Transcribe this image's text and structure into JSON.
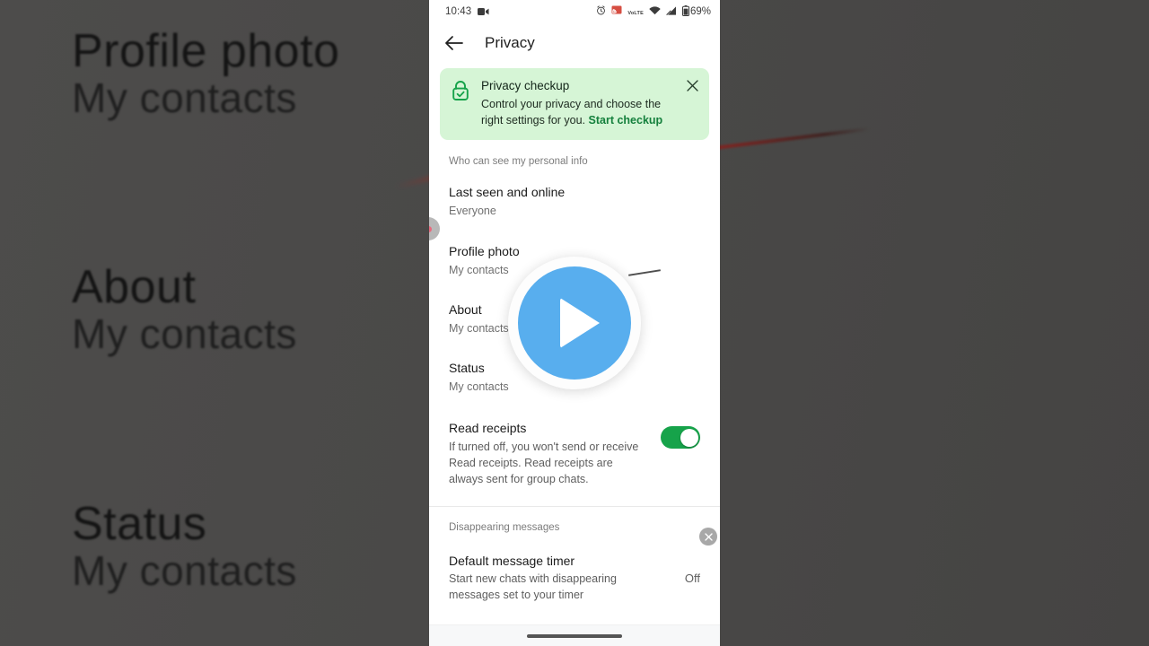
{
  "background": {
    "rows": [
      {
        "title": "Profile photo",
        "subtitle": "My contacts"
      },
      {
        "title": "About",
        "subtitle": "My contacts"
      },
      {
        "title": "Status",
        "subtitle": "My contacts"
      }
    ]
  },
  "status_bar": {
    "time": "10:43",
    "recording_icon": "screen-record-icon",
    "alarm_icon": "alarm-icon",
    "cast_icon": "cast-icon",
    "network_label": "VoLTE",
    "wifi_icon": "wifi-icon",
    "signal_icon": "signal-icon",
    "battery_icon": "battery-icon",
    "battery_level": "69%"
  },
  "app_bar": {
    "back_icon": "back-arrow-icon",
    "title": "Privacy"
  },
  "banner": {
    "icon": "lock-check-icon",
    "title": "Privacy checkup",
    "description": "Control your privacy and choose the right settings for you.",
    "link_label": "Start checkup",
    "close_icon": "close-icon",
    "bg_color": "#d6f5d6",
    "link_color": "#15803d"
  },
  "personal_info": {
    "section_label": "Who can see my personal info",
    "items": [
      {
        "title": "Last seen and online",
        "value": "Everyone"
      },
      {
        "title": "Profile photo",
        "value": "My contacts"
      },
      {
        "title": "About",
        "value": "My contacts"
      },
      {
        "title": "Status",
        "value": "My contacts"
      }
    ]
  },
  "read_receipts": {
    "title": "Read receipts",
    "description": "If turned off, you won't send or receive Read receipts. Read receipts are always sent for group chats.",
    "toggle_state": "on",
    "toggle_color": "#16a34a"
  },
  "disappearing": {
    "section_label": "Disappearing messages",
    "close_icon": "close-circle-icon",
    "item": {
      "title": "Default message timer",
      "description": "Start new chats with disappearing messages set to your timer",
      "value": "Off"
    }
  },
  "nav_bar": {
    "pill": "gesture-nav-pill"
  },
  "overlay": {
    "play_icon": "play-button-icon",
    "play_color": "#58aeee"
  },
  "cursor": {
    "indicator": "touch-indicator"
  }
}
